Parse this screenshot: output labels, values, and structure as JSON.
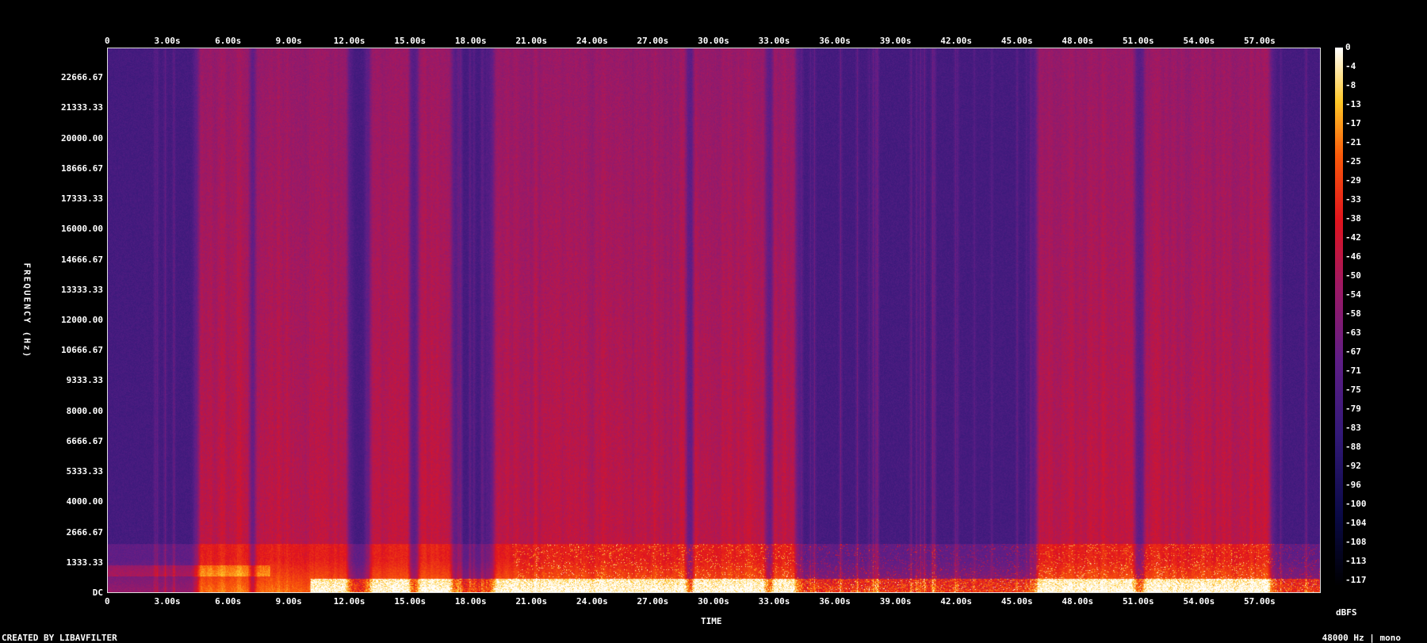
{
  "chart_data": {
    "type": "heatmap",
    "title": "",
    "xlabel": "TIME",
    "ylabel": "FREQUENCY (Hz)",
    "x_ticks": [
      "0",
      "3.00s",
      "6.00s",
      "9.00s",
      "12.00s",
      "15.00s",
      "18.00s",
      "21.00s",
      "24.00s",
      "27.00s",
      "30.00s",
      "33.00s",
      "36.00s",
      "39.00s",
      "42.00s",
      "45.00s",
      "48.00s",
      "51.00s",
      "54.00s",
      "57.00s"
    ],
    "y_ticks": [
      "DC",
      "1333.33",
      "2666.67",
      "4000.00",
      "5333.33",
      "6666.67",
      "8000.00",
      "9333.33",
      "10666.67",
      "12000.00",
      "13333.33",
      "14666.67",
      "16000.00",
      "17333.33",
      "18666.67",
      "20000.00",
      "21333.33",
      "22666.67"
    ],
    "colorbar_ticks": [
      "0",
      "-4",
      "-8",
      "-13",
      "-17",
      "-21",
      "-25",
      "-29",
      "-33",
      "-38",
      "-42",
      "-46",
      "-50",
      "-54",
      "-58",
      "-63",
      "-67",
      "-71",
      "-75",
      "-79",
      "-83",
      "-88",
      "-92",
      "-96",
      "-100",
      "-104",
      "-108",
      "-113",
      "-117"
    ],
    "colorbar_unit": "dBFS",
    "xlim": [
      0,
      60
    ],
    "ylim": [
      0,
      24000
    ],
    "colormap": "intensity (black-blue-purple-red-orange-yellow-white)",
    "bright_time_bands_s": [
      4.5,
      7.0,
      7.3,
      11.8,
      13.0,
      14.9,
      15.4,
      17.0,
      19.1,
      28.6,
      29.0,
      32.5,
      32.9,
      34.0,
      46.0,
      50.8,
      51.3,
      57.5
    ]
  },
  "footer": {
    "credit": "CREATED BY LIBAVFILTER",
    "info": "48000 Hz | mono"
  }
}
